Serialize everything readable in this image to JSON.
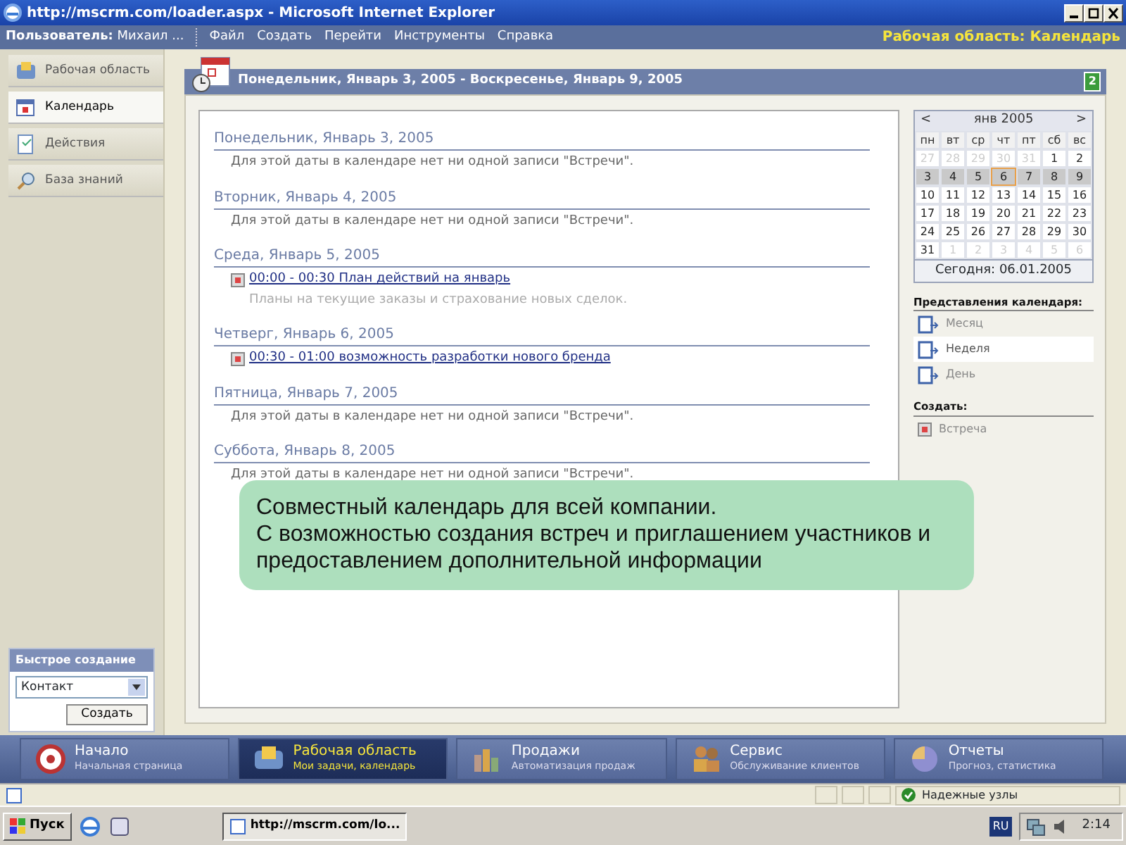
{
  "window": {
    "title": "http://mscrm.com/loader.aspx - Microsoft Internet Explorer"
  },
  "menu_bar": {
    "user_label": "Пользователь:",
    "user_name": "Михаил ...",
    "items": [
      "Файл",
      "Создать",
      "Перейти",
      "Инструменты",
      "Справка"
    ],
    "area_title": "Рабочая область: Календарь"
  },
  "sidebar": {
    "items": [
      {
        "label": "Рабочая область",
        "selected": false
      },
      {
        "label": "Календарь",
        "selected": true
      },
      {
        "label": "Действия",
        "selected": false
      },
      {
        "label": "База знаний",
        "selected": false
      }
    ],
    "quick_create": {
      "title": "Быстрое создание",
      "value": "Контакт",
      "button": "Создать"
    }
  },
  "header": {
    "title": "Понедельник, Январь 3, 2005 - Воскресенье, Январь 9, 2005",
    "badge": "2"
  },
  "days": [
    {
      "heading": "Понедельник, Январь 3, 2005",
      "kind": "empty",
      "text": "Для этой даты в календаре нет ни одной записи \"Встречи\"."
    },
    {
      "heading": "Вторник, Январь 4, 2005",
      "kind": "empty",
      "text": "Для этой даты в календаре нет ни одной записи \"Встречи\"."
    },
    {
      "heading": "Среда, Январь 5, 2005",
      "kind": "events",
      "events": [
        {
          "title": "00:00 - 00:30 План действий на январь",
          "description": "Планы на текущие заказы и страхование новых сделок."
        }
      ]
    },
    {
      "heading": "Четверг, Январь 6, 2005",
      "kind": "events",
      "events": [
        {
          "title": "00:30 - 01:00 возможность разработки нового бренда"
        }
      ]
    },
    {
      "heading": "Пятница, Январь 7, 2005",
      "kind": "empty",
      "text": "Для этой даты в календаре нет ни одной записи \"Встречи\"."
    },
    {
      "heading": "Суббота, Январь 8, 2005",
      "kind": "empty",
      "text": "Для этой даты в календаре нет ни одной записи \"Встречи\"."
    }
  ],
  "callout": {
    "lines": [
      "Совместный календарь для всей компании.",
      "С возможностью создания встреч и приглашением участников и предоставлением дополнительной информации"
    ]
  },
  "mini_calendar": {
    "prev": "<",
    "month": "янв 2005",
    "next": ">",
    "weekdays": [
      "пн",
      "вт",
      "ср",
      "чт",
      "пт",
      "сб",
      "вс"
    ],
    "weeks": [
      {
        "selected": false,
        "days": [
          {
            "label": "27",
            "outside": true
          },
          {
            "label": "28",
            "outside": true
          },
          {
            "label": "29",
            "outside": true
          },
          {
            "label": "30",
            "outside": true
          },
          {
            "label": "31",
            "outside": true
          },
          {
            "label": "1",
            "outside": false
          },
          {
            "label": "2",
            "outside": false
          }
        ]
      },
      {
        "selected": true,
        "days": [
          {
            "label": "3",
            "outside": false
          },
          {
            "label": "4",
            "outside": false
          },
          {
            "label": "5",
            "outside": false
          },
          {
            "label": "6",
            "outside": false,
            "today": true
          },
          {
            "label": "7",
            "outside": false
          },
          {
            "label": "8",
            "outside": false
          },
          {
            "label": "9",
            "outside": false
          }
        ]
      },
      {
        "selected": false,
        "days": [
          {
            "label": "10",
            "outside": false
          },
          {
            "label": "11",
            "outside": false
          },
          {
            "label": "12",
            "outside": false
          },
          {
            "label": "13",
            "outside": false
          },
          {
            "label": "14",
            "outside": false
          },
          {
            "label": "15",
            "outside": false
          },
          {
            "label": "16",
            "outside": false
          }
        ]
      },
      {
        "selected": false,
        "days": [
          {
            "label": "17",
            "outside": false
          },
          {
            "label": "18",
            "outside": false
          },
          {
            "label": "19",
            "outside": false
          },
          {
            "label": "20",
            "outside": false
          },
          {
            "label": "21",
            "outside": false
          },
          {
            "label": "22",
            "outside": false
          },
          {
            "label": "23",
            "outside": false
          }
        ]
      },
      {
        "selected": false,
        "days": [
          {
            "label": "24",
            "outside": false
          },
          {
            "label": "25",
            "outside": false
          },
          {
            "label": "26",
            "outside": false
          },
          {
            "label": "27",
            "outside": false
          },
          {
            "label": "28",
            "outside": false
          },
          {
            "label": "29",
            "outside": false
          },
          {
            "label": "30",
            "outside": false
          }
        ]
      },
      {
        "selected": false,
        "days": [
          {
            "label": "31",
            "outside": false
          },
          {
            "label": "1",
            "outside": true
          },
          {
            "label": "2",
            "outside": true
          },
          {
            "label": "3",
            "outside": true
          },
          {
            "label": "4",
            "outside": true
          },
          {
            "label": "5",
            "outside": true
          },
          {
            "label": "6",
            "outside": true
          }
        ]
      }
    ],
    "today": "Сегодня: 06.01.2005"
  },
  "views": {
    "title": "Представления календаря:",
    "items": [
      {
        "label": "Месяц",
        "selected": false
      },
      {
        "label": "Неделя",
        "selected": true
      },
      {
        "label": "День",
        "selected": false
      }
    ]
  },
  "create": {
    "title": "Создать:",
    "items": [
      "Встреча"
    ]
  },
  "bottom_nav": [
    {
      "title": "Начало",
      "subtitle": "Начальная страница",
      "selected": false
    },
    {
      "title": "Рабочая область",
      "subtitle": "Мои задачи, календарь",
      "selected": true
    },
    {
      "title": "Продажи",
      "subtitle": "Автоматизация продаж",
      "selected": false
    },
    {
      "title": "Сервис",
      "subtitle": "Обслуживание клиентов",
      "selected": false
    },
    {
      "title": "Отчеты",
      "subtitle": "Прогноз, статистика",
      "selected": false
    }
  ],
  "status_bar": {
    "zone": "Надежные узлы"
  },
  "taskbar": {
    "start": "Пуск",
    "task": "http://mscrm.com/lo...",
    "language": "RU",
    "clock": "2:14"
  }
}
